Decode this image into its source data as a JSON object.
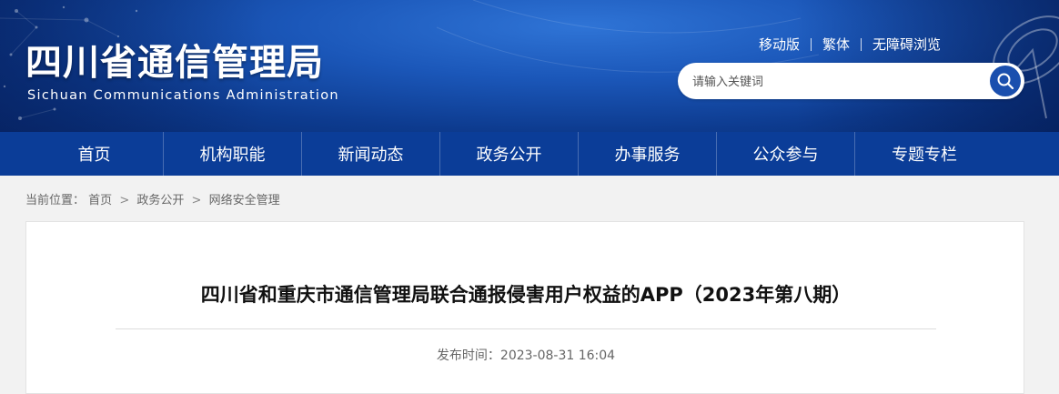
{
  "header": {
    "title_cn": "四川省通信管理局",
    "title_en": "Sichuan Communications Administration",
    "links": [
      {
        "label": "移动版"
      },
      {
        "label": "繁体"
      },
      {
        "label": "无障碍浏览"
      }
    ],
    "search": {
      "placeholder": "请输入关键词",
      "value": "",
      "icon": "search-icon"
    }
  },
  "nav": {
    "items": [
      {
        "label": "首页"
      },
      {
        "label": "机构职能"
      },
      {
        "label": "新闻动态"
      },
      {
        "label": "政务公开"
      },
      {
        "label": "办事服务"
      },
      {
        "label": "公众参与"
      },
      {
        "label": "专题专栏"
      }
    ]
  },
  "breadcrumb": {
    "prefix": "当前位置：",
    "items": [
      "首页",
      "政务公开",
      "网络安全管理"
    ],
    "separator": ">"
  },
  "article": {
    "title": "四川省和重庆市通信管理局联合通报侵害用户权益的APP（2023年第八期）",
    "meta_label": "发布时间：",
    "meta_value": "2023-08-31 16:04"
  },
  "colors": {
    "header_blue": "#1b57b9",
    "nav_blue": "#0b3d98",
    "search_button": "#1a4fae",
    "page_bg": "#f2f2f2"
  }
}
